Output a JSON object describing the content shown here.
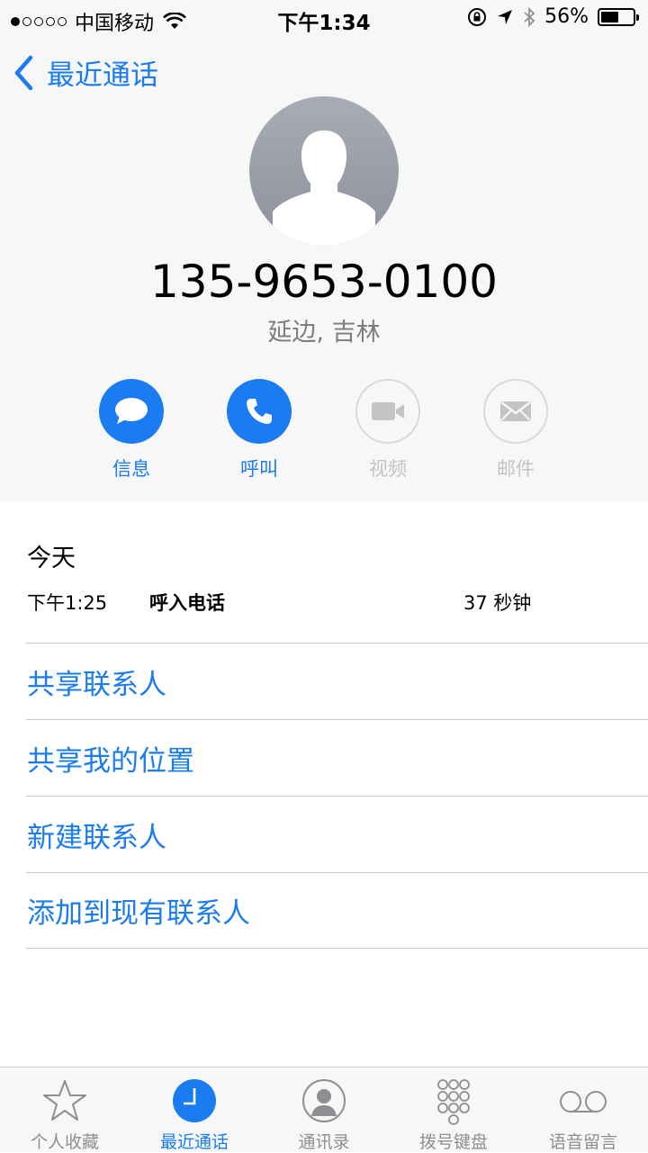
{
  "status_bar": {
    "carrier": "中国移动",
    "time": "下午1:34",
    "battery_text": "56%",
    "battery_level": 0.56
  },
  "nav": {
    "back_label": "最近通话"
  },
  "contact": {
    "number": "135-9653-0100",
    "location": "延边, 吉林"
  },
  "actions": [
    {
      "label": "信息",
      "icon": "message-icon",
      "enabled": true
    },
    {
      "label": "呼叫",
      "icon": "phone-icon",
      "enabled": true
    },
    {
      "label": "视频",
      "icon": "video-icon",
      "enabled": false
    },
    {
      "label": "邮件",
      "icon": "mail-icon",
      "enabled": false
    }
  ],
  "history": {
    "day": "今天",
    "entries": [
      {
        "time": "下午1:25",
        "type": "呼入电话",
        "duration": "37 秒钟"
      }
    ]
  },
  "options": [
    {
      "label": "共享联系人"
    },
    {
      "label": "共享我的位置"
    },
    {
      "label": "新建联系人"
    },
    {
      "label": "添加到现有联系人"
    }
  ],
  "tabs": [
    {
      "label": "个人收藏",
      "icon": "star-icon"
    },
    {
      "label": "最近通话",
      "icon": "clock-icon",
      "active": true
    },
    {
      "label": "通讯录",
      "icon": "contacts-icon"
    },
    {
      "label": "拨号键盘",
      "icon": "keypad-icon"
    },
    {
      "label": "语音留言",
      "icon": "voicemail-icon"
    }
  ],
  "colors": {
    "accent": "#1a7cf0",
    "disabled": "#c4c4c4",
    "secondary_text": "#7d7d7d"
  }
}
